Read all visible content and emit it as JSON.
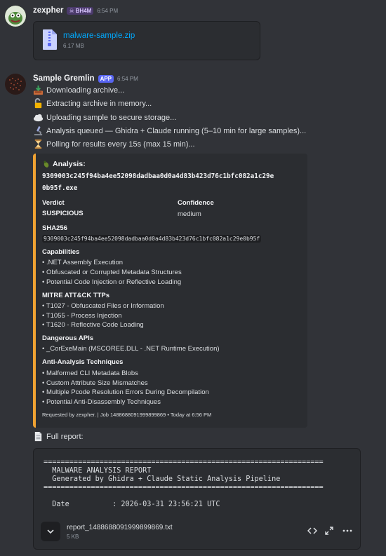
{
  "message1": {
    "author": "zexpher",
    "role_tag": "BH4M",
    "time": "6:54 PM",
    "attachment": {
      "name": "malware-sample.zip",
      "size": "6.17 MB",
      "icon": "zip-file-icon"
    }
  },
  "message2": {
    "author": "Sample Gremlin",
    "app_tag": "APP",
    "time": "6:54 PM",
    "lines": [
      {
        "icon": "inbox-tray-icon",
        "text": "Downloading archive..."
      },
      {
        "icon": "unlock-icon",
        "text": "Extracting archive in memory..."
      },
      {
        "icon": "cloud-icon",
        "text": "Uploading sample to secure storage..."
      },
      {
        "icon": "microscope-icon",
        "text": "Analysis queued — Ghidra + Claude running (5–10 min for large samples)..."
      },
      {
        "icon": "hourglass-icon",
        "text": "Polling for results every 15s (max 15 min)..."
      }
    ],
    "embed": {
      "accent": "#f0a232",
      "title_prefix": "Analysis:",
      "title_line1": "9309003c245f94ba4ee52098dadbaa0d0a4d83b423d76c1bfc082a1c29e",
      "title_line2": "0b95f.exe",
      "verdict_label": "Verdict",
      "verdict_value": "SUSPICIOUS",
      "confidence_label": "Confidence",
      "confidence_value": "medium",
      "sha_label": "SHA256",
      "sha_value": "9309003c245f94ba4ee52098dadbaa0d0a4d83b423d76c1bfc082a1c29e0b95f",
      "capabilities_label": "Capabilities",
      "capabilities": [
        "• .NET Assembly Execution",
        "• Obfuscated or Corrupted Metadata Structures",
        "• Potential Code Injection or Reflective Loading"
      ],
      "ttps_label": "MITRE ATT&CK TTPs",
      "ttps": [
        "• T1027 - Obfuscated Files or Information",
        "• T1055 - Process Injection",
        "• T1620 - Reflective Code Loading"
      ],
      "apis_label": "Dangerous APIs",
      "apis": [
        "• _CorExeMain (MSCOREE.DLL - .NET Runtime Execution)"
      ],
      "anti_label": "Anti-Analysis Techniques",
      "anti": [
        "• Malformed CLI Metadata Blobs",
        "• Custom Attribute Size Mismatches",
        "• Multiple Pcode Resolution Errors During Decompilation",
        "• Potential Anti-Disassembly Techniques"
      ],
      "footer": "Requested by zexpher. | Job 1488688091999899869 • Today at 6:56 PM"
    },
    "full_report_label": "Full report:",
    "report": {
      "preview": "=================================================================\n  MALWARE ANALYSIS REPORT\n  Generated by Ghidra + Claude Static Analysis Pipeline\n=================================================================\n\n  Date          : 2026-03-31 23:56:21 UTC",
      "file_name": "report_1488688091999899869.txt",
      "file_size": "5 KB"
    }
  }
}
